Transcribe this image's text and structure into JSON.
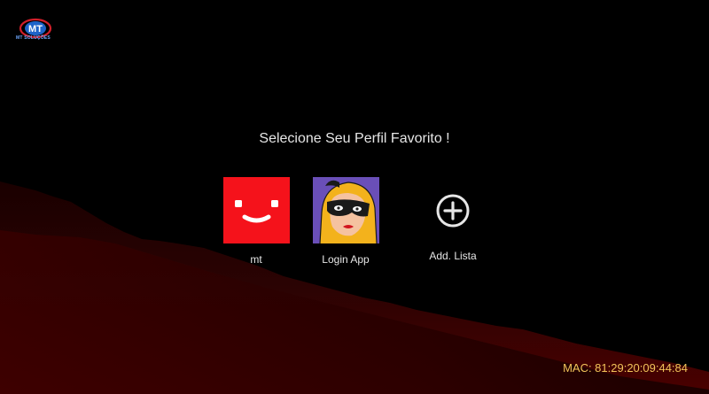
{
  "logo": {
    "mark_text": "MT",
    "caption": "MT SOLUÇÕES"
  },
  "title": "Selecione Seu Perfil Favorito !",
  "profiles": [
    {
      "label": "mt",
      "icon": "smiley-face-icon",
      "color": "#f5121b"
    },
    {
      "label": "Login App",
      "icon": "masked-woman-avatar-icon",
      "color": "#6a4fb8"
    }
  ],
  "add_list": {
    "label": "Add. Lista",
    "icon": "plus-circle-icon"
  },
  "mac": "MAC: 81:29:20:09:44:84",
  "colors": {
    "background": "#000000",
    "background_glow": "#4a0000",
    "mac_text": "#f2c45a",
    "text": "#e6e6e6"
  }
}
